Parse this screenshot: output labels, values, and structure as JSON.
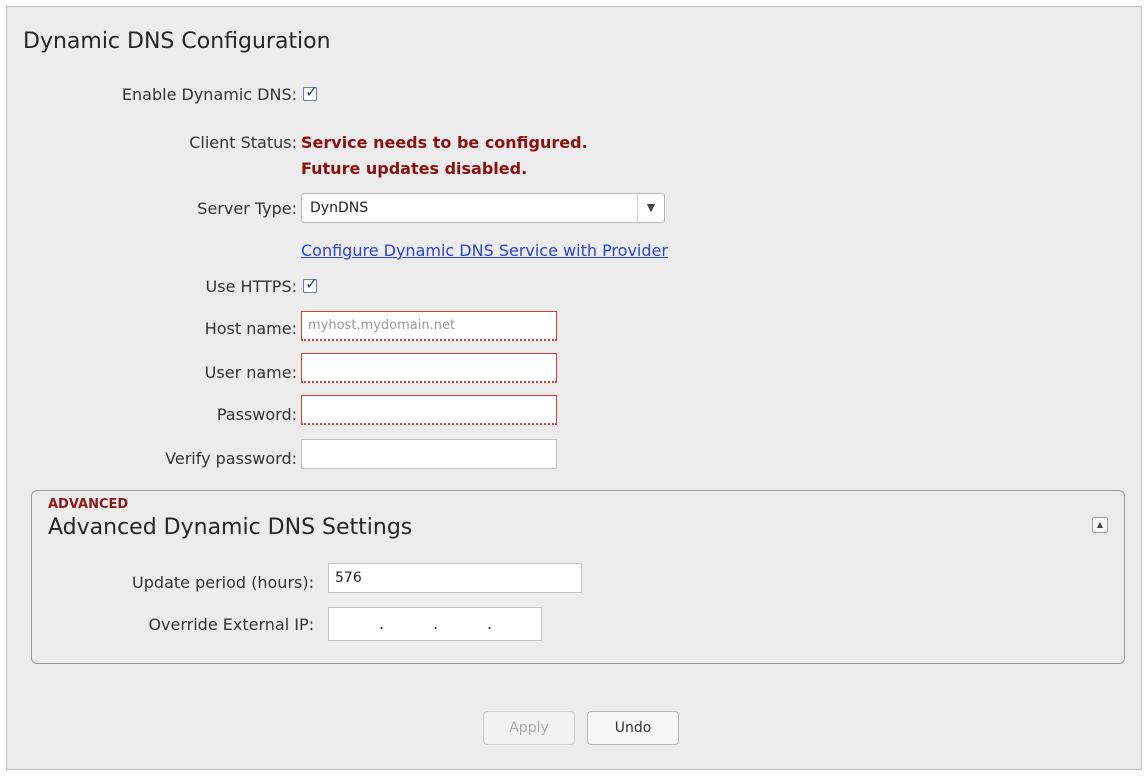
{
  "page": {
    "title": "Dynamic DNS Configuration"
  },
  "form": {
    "enable_label": "Enable Dynamic DNS:",
    "enable_checked": true,
    "client_status_label": "Client Status:",
    "client_status_line1": "Service needs to be configured.",
    "client_status_line2": "Future updates disabled.",
    "server_type_label": "Server Type:",
    "server_type_value": "DynDNS",
    "configure_link": "Configure Dynamic DNS Service with Provider",
    "https_label": "Use HTTPS:",
    "https_checked": true,
    "host_label": "Host name:",
    "host_placeholder": "myhost.mydomain.net",
    "user_label": "User name:",
    "user_value": "",
    "password_label": "Password:",
    "password_value": "",
    "verify_label": "Verify password:",
    "verify_value": ""
  },
  "advanced": {
    "tag": "ADVANCED",
    "title": "Advanced Dynamic DNS Settings",
    "update_label": "Update period (hours):",
    "update_value": "576",
    "override_label": "Override External IP:",
    "ip_dots": [
      ".",
      ".",
      "."
    ]
  },
  "buttons": {
    "apply": "Apply",
    "undo": "Undo"
  },
  "colors": {
    "status_red": "#8b0f0f",
    "link_blue": "#2a45c7",
    "error_border": "#d53c3c"
  }
}
